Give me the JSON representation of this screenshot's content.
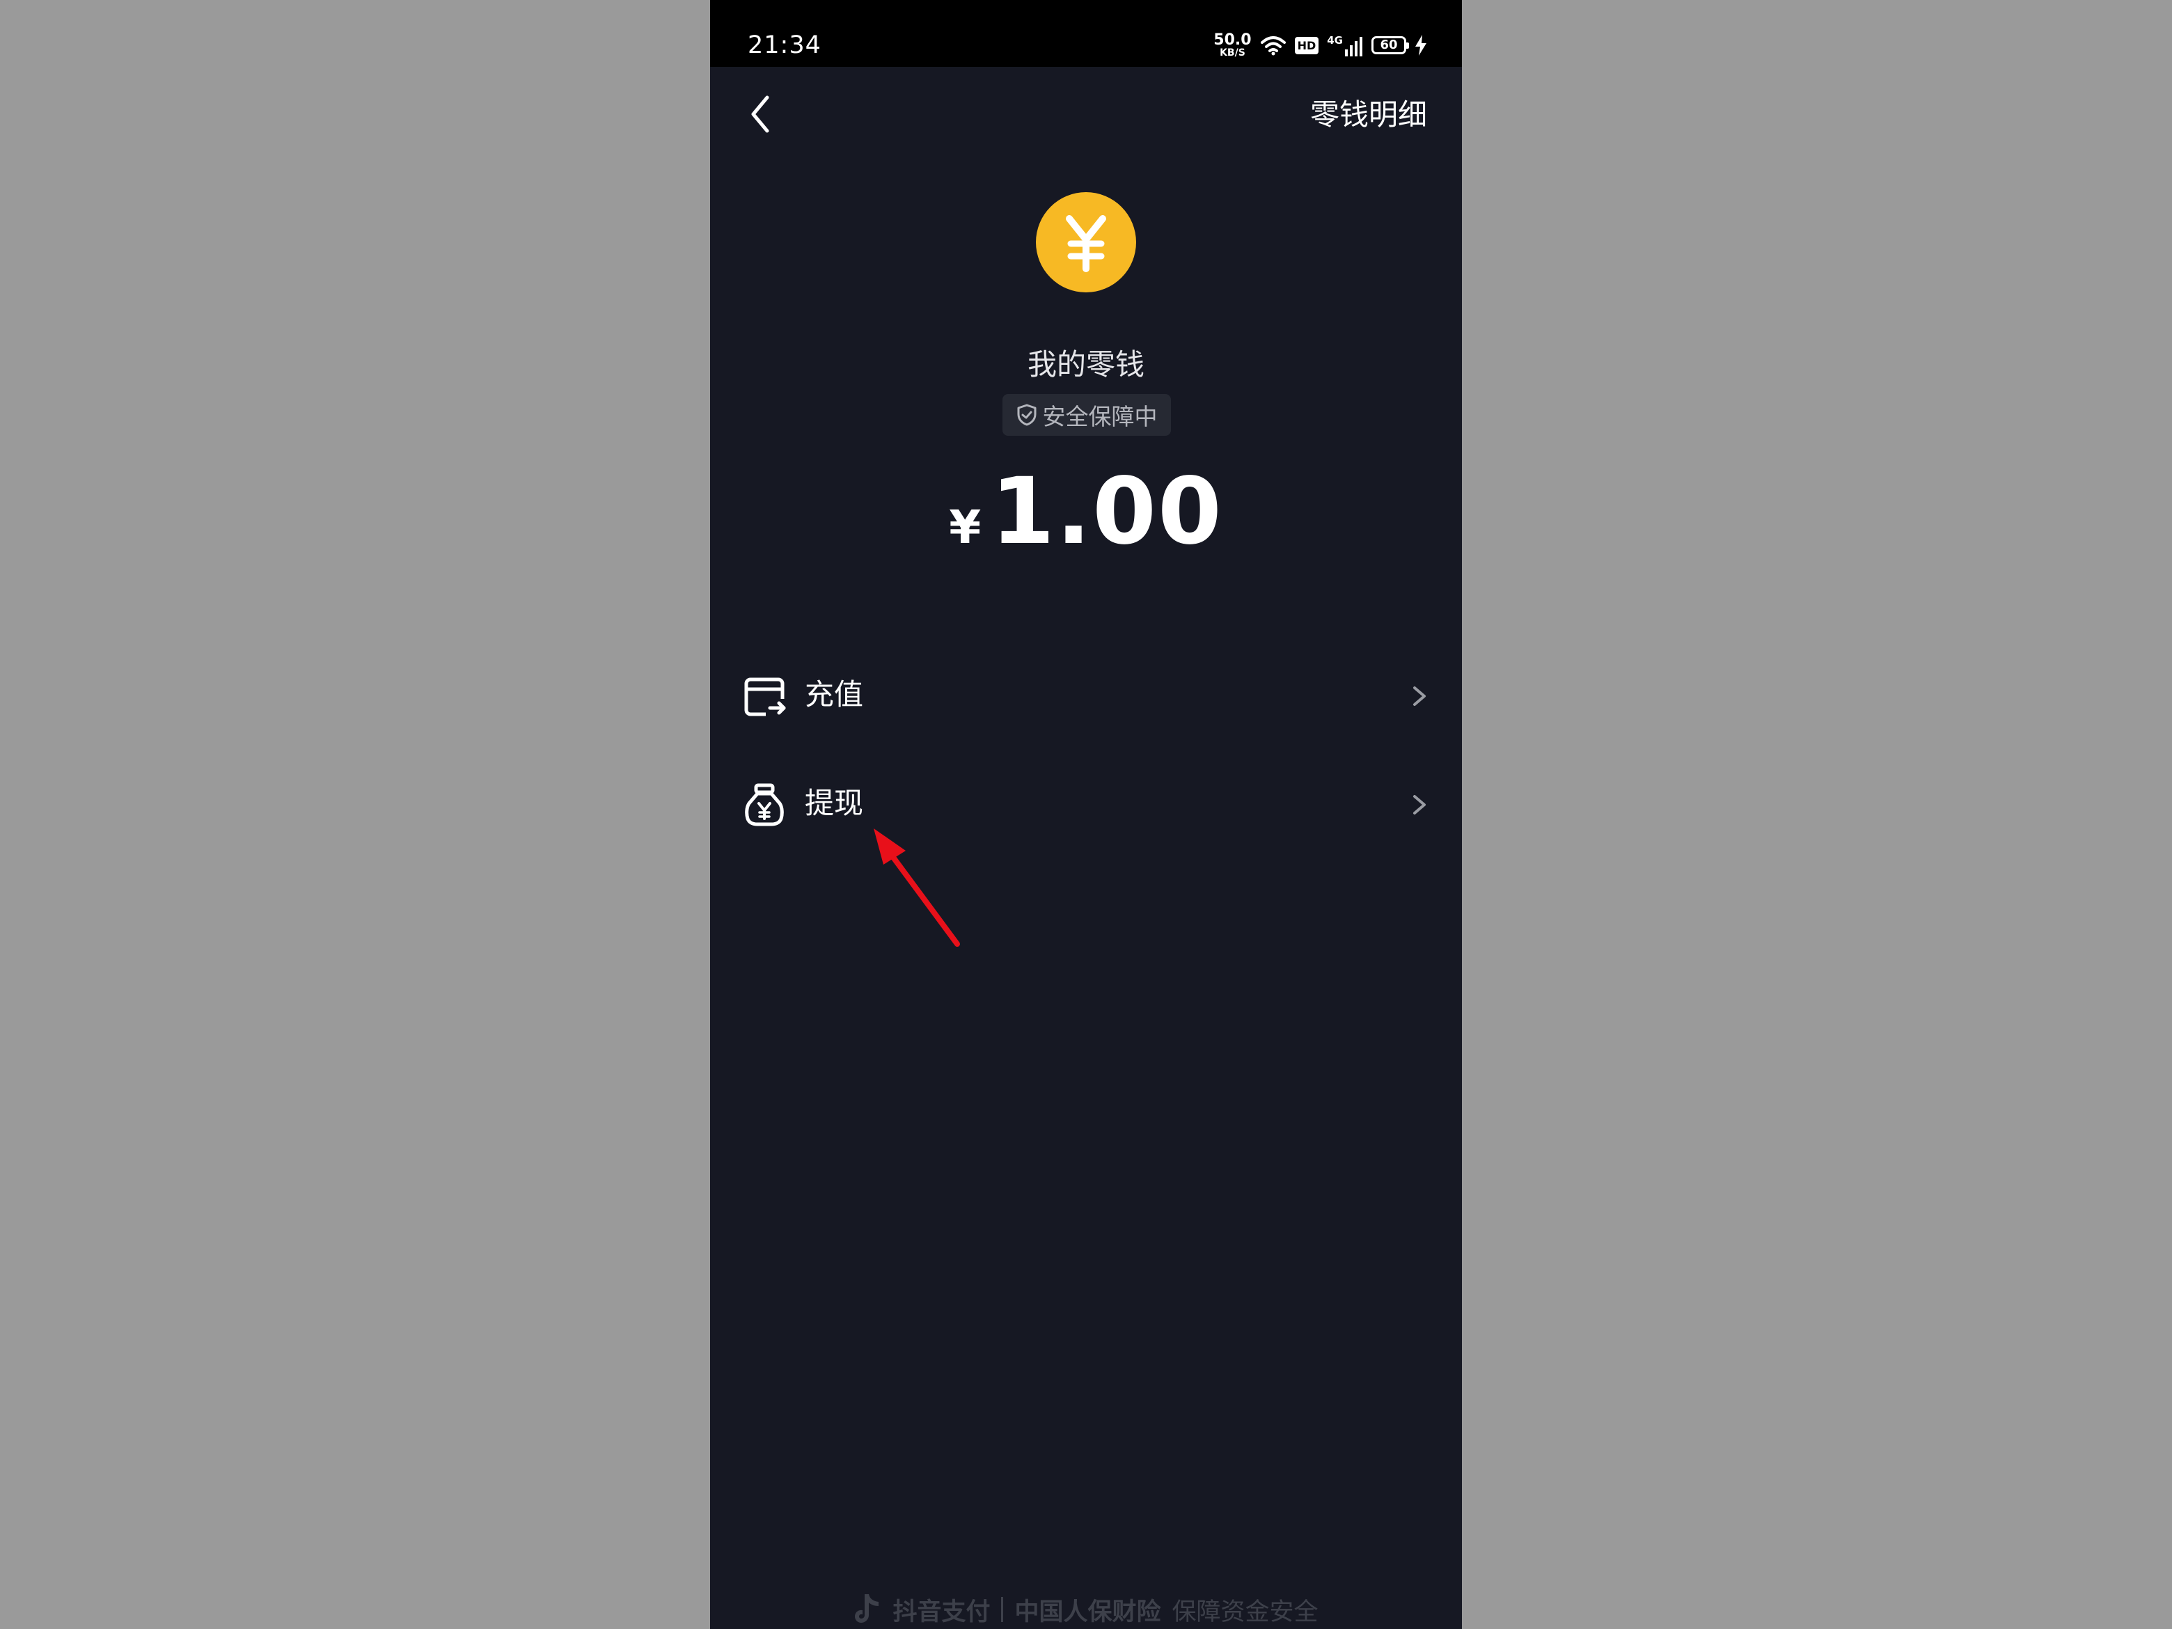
{
  "status_bar": {
    "time": "21:34",
    "net_speed_value": "50.0",
    "net_speed_unit": "KB/S",
    "hd": "HD",
    "signal": "4G",
    "battery": "60"
  },
  "header": {
    "details_link": "零钱明细"
  },
  "wallet": {
    "title": "我的零钱",
    "security_badge": "安全保障中",
    "currency_symbol": "¥",
    "balance": "1.00"
  },
  "menu": [
    {
      "label": "充值",
      "icon": "card-recharge-icon"
    },
    {
      "label": "提现",
      "icon": "money-bag-icon"
    }
  ],
  "footer": {
    "brand": "抖音支付",
    "insurer": "中国人保财险",
    "slogan": "保障资金安全"
  },
  "colors": {
    "background": "#161823",
    "coin": "#f7b924",
    "annotation_arrow": "#e8101a"
  }
}
